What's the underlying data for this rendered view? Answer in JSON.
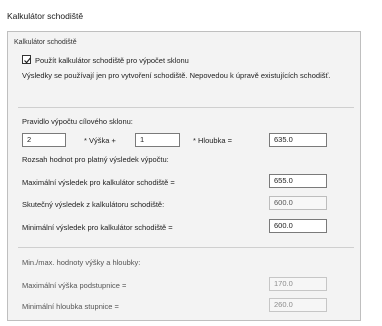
{
  "title": "Kalkulátor schodiště",
  "group": {
    "label": "Kalkulátor schodiště",
    "use_checkbox": {
      "label": "Použít kalkulátor schodiště pro výpočet sklonu",
      "checked": true
    },
    "note": "Výsledky se používají jen pro vytvoření schodiště. Nepovedou k úpravě existujících schodišť."
  },
  "rule": {
    "heading": "Pravidlo výpočtu cílového sklonu:",
    "multiplier_height": "2",
    "height_label": "* Výška +",
    "multiplier_depth": "1",
    "depth_label": "* Hloubka =",
    "result": "635.0"
  },
  "range": {
    "heading": "Rozsah hodnot pro platný výsledek výpočtu:",
    "max_label": "Maximální výsledek pro kalkulátor schodiště =",
    "max_value": "655.0",
    "actual_label": "Skutečný výsledek z kalkulátoru schodiště:",
    "actual_value": "600.0",
    "min_label": "Minimální výsledek pro kalkulátor schodiště =",
    "min_value": "600.0"
  },
  "minmax": {
    "heading": "Min./max. hodnoty výšky a hloubky:",
    "max_riser_label": "Maximální výška podstupnice =",
    "max_riser_value": "170.0",
    "min_tread_label": "Minimální hloubka stupnice =",
    "min_tread_value": "260.0"
  }
}
